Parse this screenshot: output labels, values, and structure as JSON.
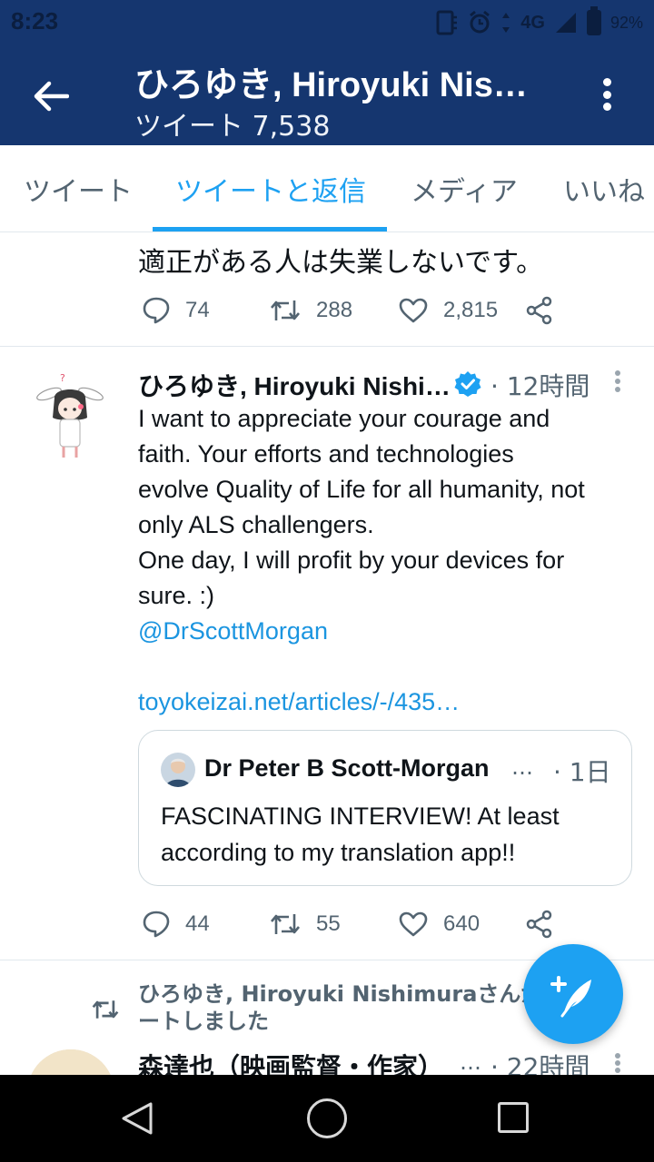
{
  "status_bar": {
    "time": "8:23",
    "network": "4G",
    "battery": "92%"
  },
  "app_bar": {
    "title": "ひろゆき, Hiroyuki Nishimura",
    "subtitle": "ツイート 7,538",
    "background": "#15366f"
  },
  "tabs": [
    {
      "label": "ツイート",
      "active": false
    },
    {
      "label": "ツイートと返信",
      "active": true
    },
    {
      "label": "メディア",
      "active": false
    },
    {
      "label": "いいね",
      "active": false
    }
  ],
  "prev_tweet": {
    "text_tail": "適正がある人は失業しないです。",
    "replies": "74",
    "retweets": "288",
    "likes": "2,815"
  },
  "tweet": {
    "author": "ひろゆき, Hiroyuki Nishi…",
    "time": "· 12時間",
    "lines": [
      "I want to appreciate your courage and",
      "faith. Your efforts and technologies",
      "evolve Quality of Life for all humanity, not",
      "only ALS challengers.",
      "One day, I will profit by your devices for",
      "sure. :)"
    ],
    "mention": "@DrScottMorgan",
    "url": "toyokeizai.net/articles/-/435…",
    "quote": {
      "author": "Dr Peter B Scott-Morgan",
      "ellipsis": "…",
      "time": "· 1日",
      "text": "FASCINATING INTERVIEW! At least according to my translation app!!"
    },
    "replies": "44",
    "retweets": "55",
    "likes": "640"
  },
  "next_tweet": {
    "retweet_note": "ひろゆき, Hiroyuki Nishimuraさんがリツイートしました",
    "author": "森達也（映画監督・作家）",
    "ellipsis": "…",
    "time": "· 22時間"
  },
  "colors": {
    "accent": "#1da1f2",
    "link": "#1b95e0",
    "muted": "#536471"
  }
}
